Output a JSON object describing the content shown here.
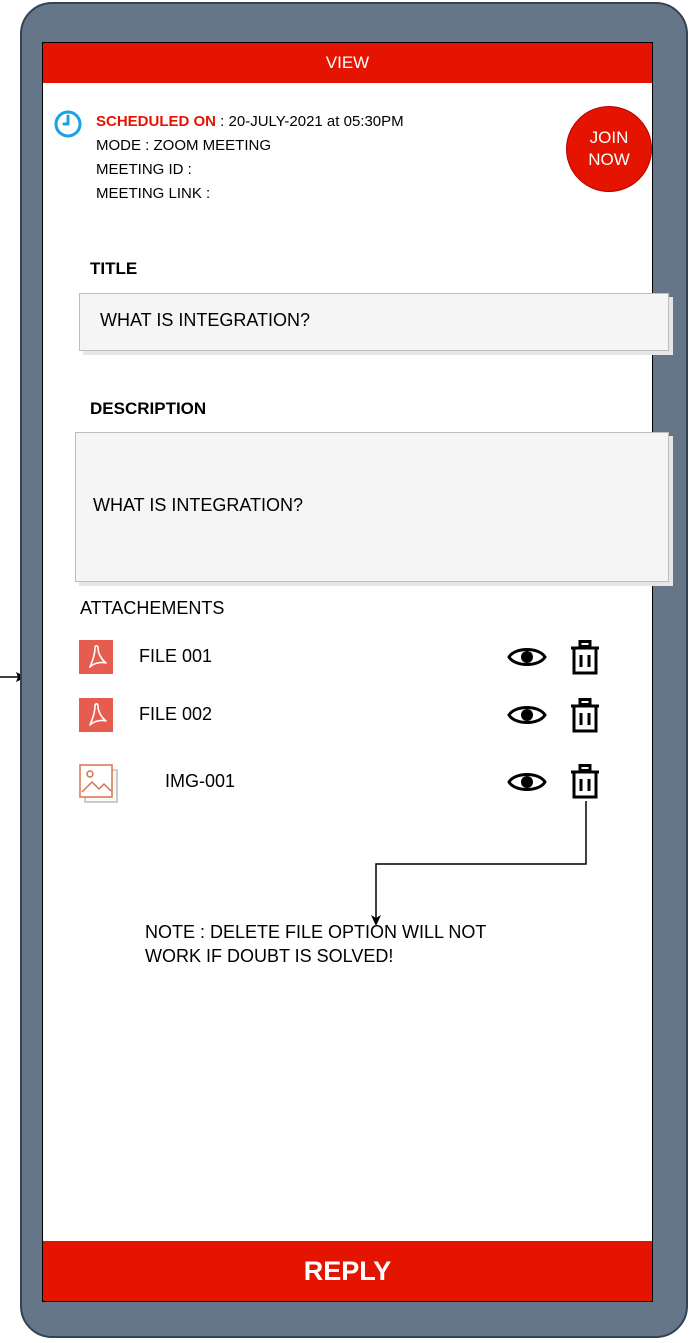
{
  "header": {
    "title": "VIEW"
  },
  "schedule": {
    "label": "SCHEDULED ON",
    "value": " : 20-JULY-2021 at 05:30PM",
    "mode": "MODE : ZOOM MEETING",
    "meeting_id": "MEETING ID :",
    "meeting_link": "MEETING LINK :"
  },
  "join_button": {
    "line1": "JOIN",
    "line2": "NOW"
  },
  "title_section": {
    "label": "TITLE",
    "value": "WHAT IS INTEGRATION?"
  },
  "description_section": {
    "label": "DESCRIPTION",
    "value": "WHAT IS INTEGRATION?"
  },
  "attachments": {
    "label": "ATTACHEMENTS",
    "items": [
      {
        "name": "FILE 001",
        "icon": "pdf-icon"
      },
      {
        "name": "FILE 002",
        "icon": "pdf-icon"
      },
      {
        "name": "IMG-001",
        "icon": "image-icon"
      }
    ]
  },
  "note": {
    "line1": "NOTE : DELETE FILE OPTION WILL NOT",
    "line2": "WORK IF DOUBT IS SOLVED!"
  },
  "reply_button": {
    "label": "REPLY"
  },
  "colors": {
    "accent": "#e51400",
    "frame": "#647687",
    "clock": "#1ba1e2"
  }
}
